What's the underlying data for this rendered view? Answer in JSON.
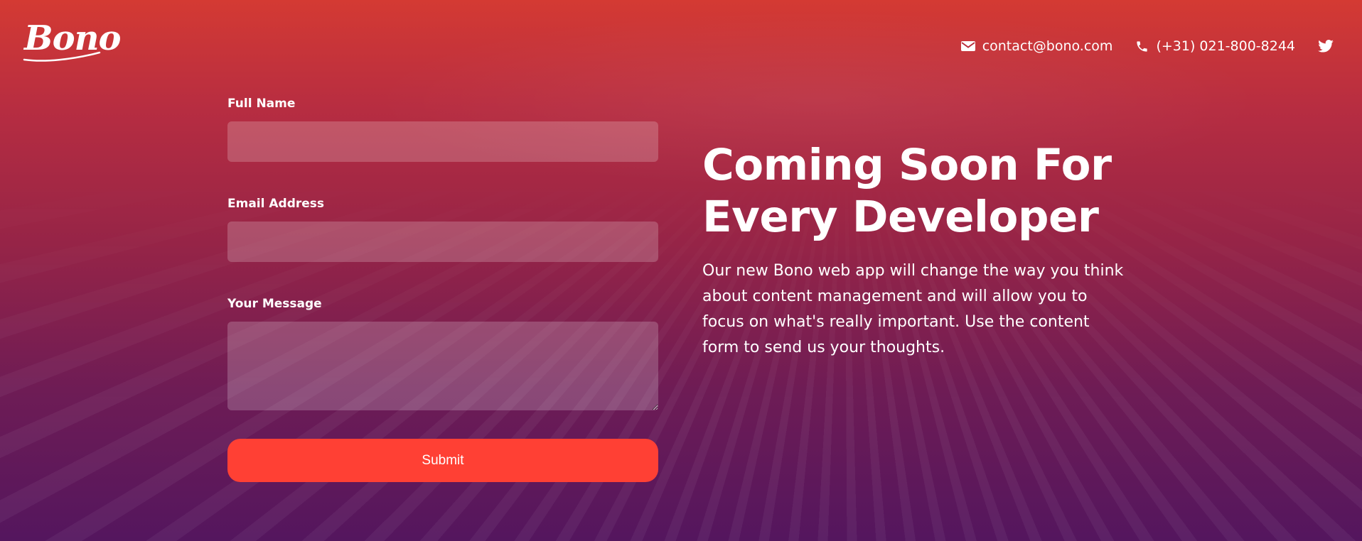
{
  "brand": {
    "logo_text": "Bono"
  },
  "header": {
    "email": "contact@bono.com",
    "phone": "(+31) 021-800-8244",
    "icons": [
      "envelope-icon",
      "phone-icon",
      "twitter-icon"
    ]
  },
  "form": {
    "full_name_label": "Full Name",
    "full_name_value": "",
    "email_label": "Email Address",
    "email_value": "",
    "message_label": "Your Message",
    "message_value": "",
    "submit_label": "Submit"
  },
  "hero": {
    "title_line1": "Coming Soon For",
    "title_line2": "Every Developer",
    "description": "Our new Bono web app will change the way you think about content management and will allow you to focus on what's really important. Use the content form to send us your thoughts."
  },
  "colors": {
    "accent": "#ff4034",
    "gradient_top": "#d43a33",
    "gradient_bottom": "#54165e"
  }
}
